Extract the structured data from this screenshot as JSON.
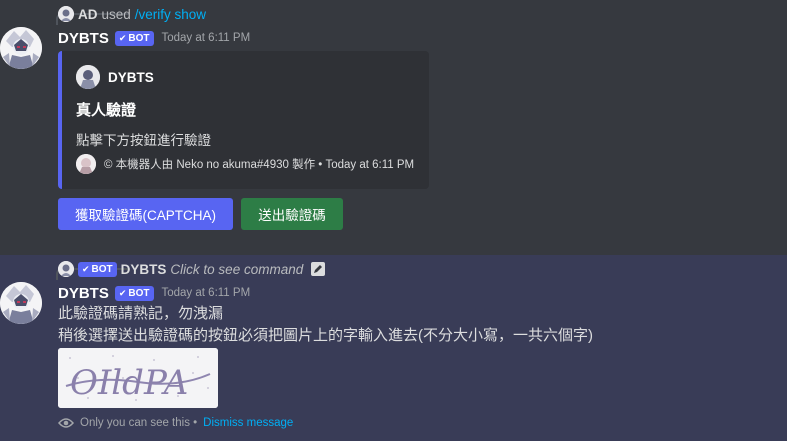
{
  "message1": {
    "reply": {
      "user": "AD",
      "action": "used",
      "command": "/verify show"
    },
    "author": "DYBTS",
    "bot_tag": "BOT",
    "timestamp": "Today at 6:11 PM",
    "embed": {
      "author_name": "DYBTS",
      "title": "真人驗證",
      "description": "點擊下方按鈕進行驗證",
      "footer": "© 本機器人由 Neko no akuma#4930 製作 • Today at 6:11 PM",
      "accent_color": "#5865f2"
    },
    "buttons": {
      "captcha_label": "獲取驗證碼(CAPTCHA)",
      "submit_label": "送出驗證碼"
    }
  },
  "message2": {
    "reply": {
      "bot_tag": "BOT",
      "user": "DYBTS",
      "text": "Click to see command"
    },
    "author": "DYBTS",
    "bot_tag": "BOT",
    "timestamp": "Today at 6:11 PM",
    "line1": "此驗證碼請熟記，勿洩漏",
    "line2": "稍後選擇送出驗證碼的按鈕必須把圖片上的字輸入進去(不分大小寫，一共六個字)",
    "captcha_image_text": "OIldPA",
    "ephemeral_note": "Only you can see this •",
    "dismiss_label": "Dismiss message"
  },
  "colors": {
    "background": "#36393f",
    "highlight": "#393c57",
    "blurple": "#5865f2",
    "green": "#2d7d46",
    "link": "#00aff4"
  }
}
